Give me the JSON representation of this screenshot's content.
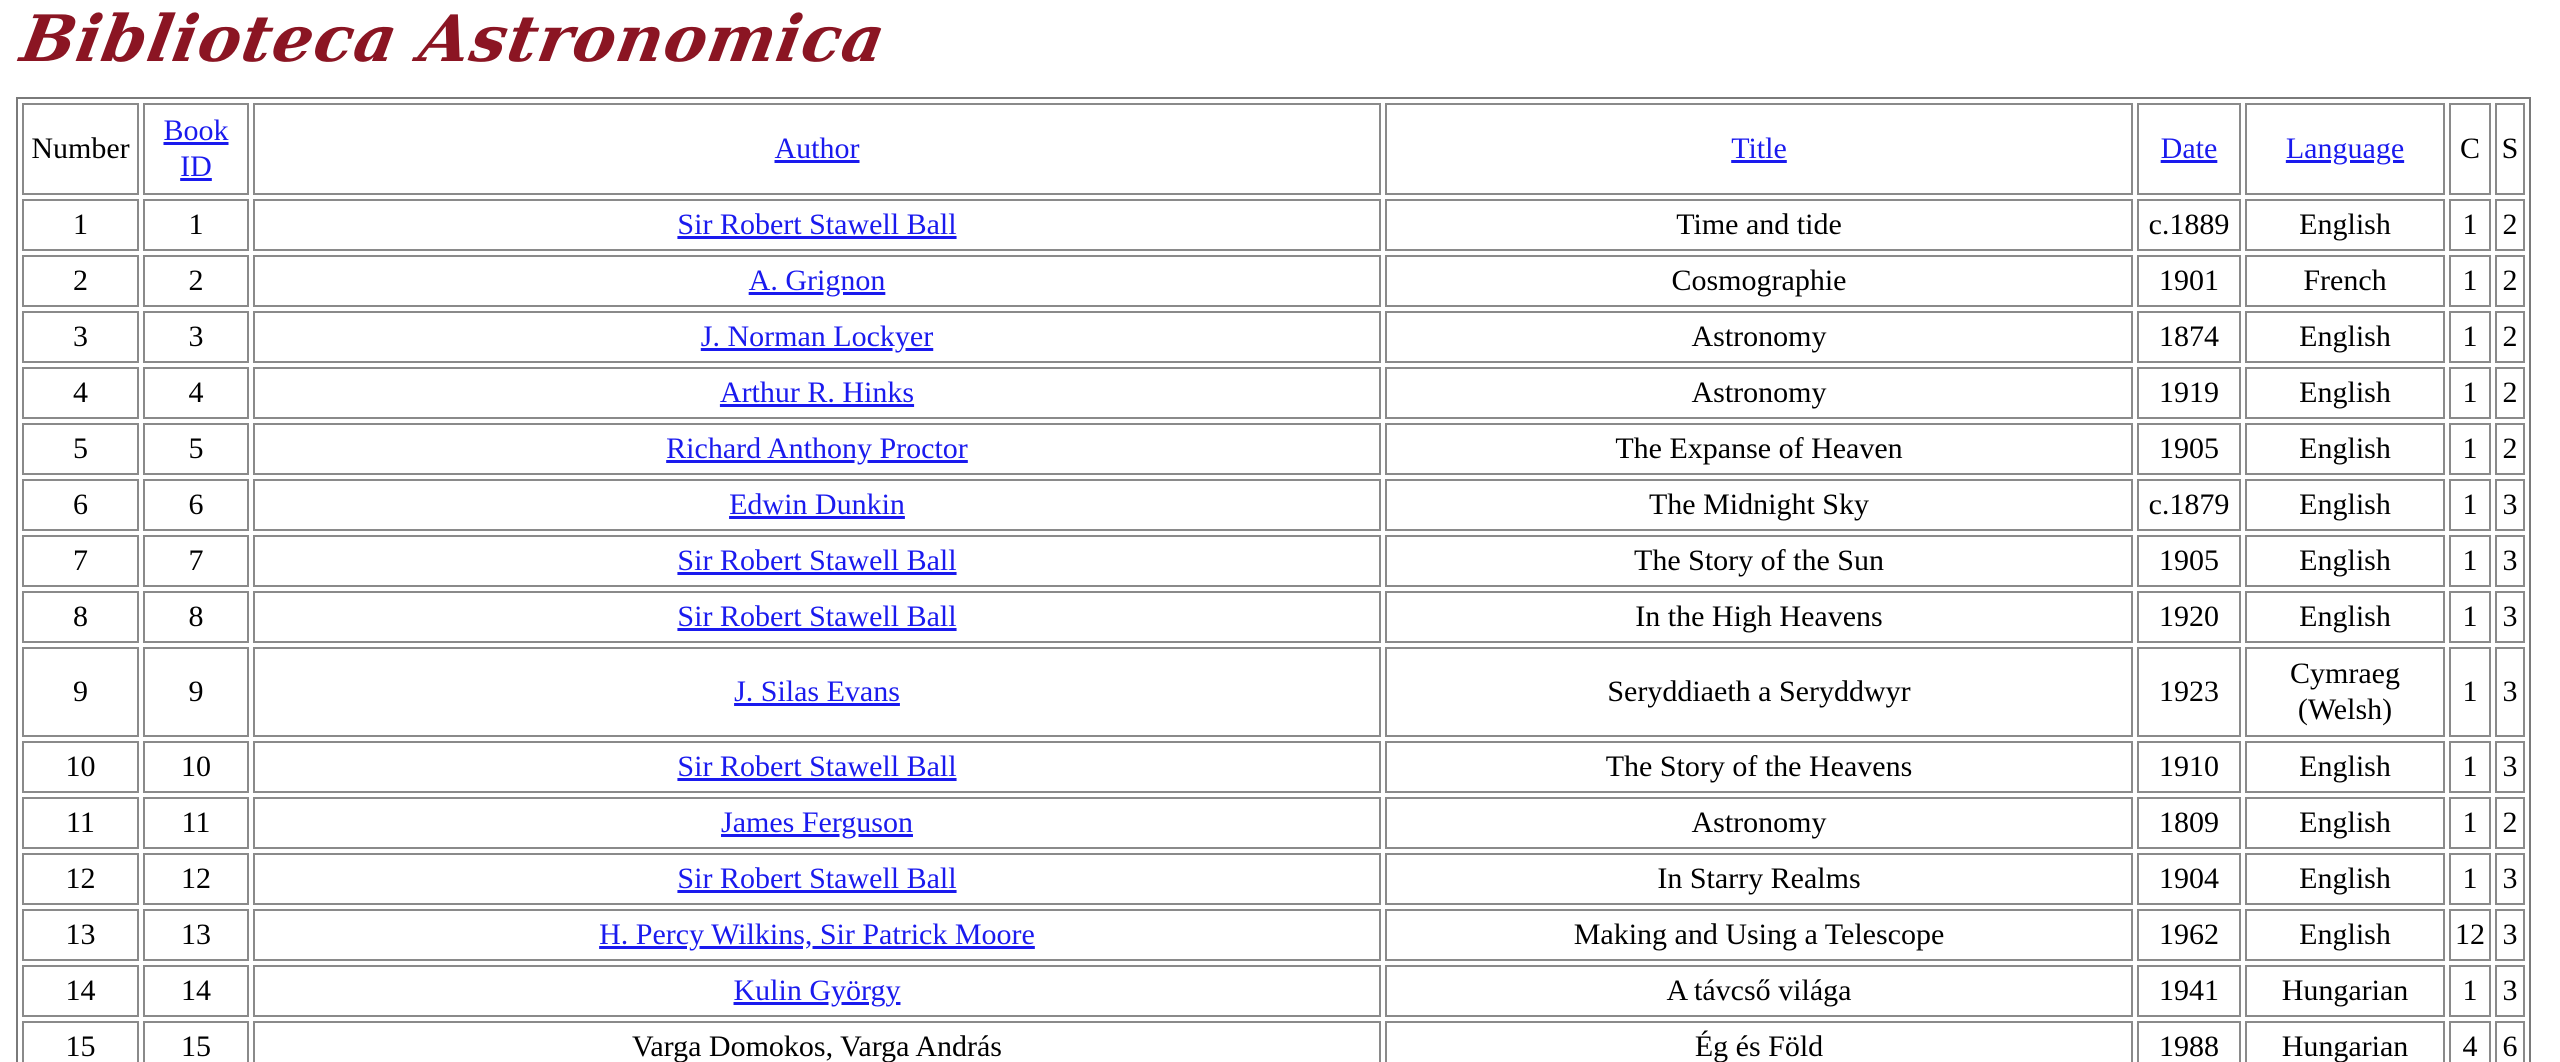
{
  "site": {
    "logo_text": "Biblioteca Astronomica"
  },
  "colors": {
    "logo": "#8b1523",
    "link": "#1a1aee",
    "border": "#8a8a8a"
  },
  "table": {
    "headers": {
      "number": "Number",
      "book_id": "Book ID",
      "author": "Author",
      "title": "Title",
      "date": "Date",
      "language": "Language",
      "c": "C",
      "s": "S"
    },
    "rows": [
      {
        "number": "1",
        "book_id": "1",
        "author": "Sir Robert Stawell Ball",
        "author_link": true,
        "title": "Time and tide",
        "date": "c.1889",
        "language": "English",
        "c": "1",
        "s": "2"
      },
      {
        "number": "2",
        "book_id": "2",
        "author": "A. Grignon",
        "author_link": true,
        "title": "Cosmographie",
        "date": "1901",
        "language": "French",
        "c": "1",
        "s": "2"
      },
      {
        "number": "3",
        "book_id": "3",
        "author": "J. Norman Lockyer",
        "author_link": true,
        "title": "Astronomy",
        "date": "1874",
        "language": "English",
        "c": "1",
        "s": "2"
      },
      {
        "number": "4",
        "book_id": "4",
        "author": "Arthur R. Hinks",
        "author_link": true,
        "title": "Astronomy",
        "date": "1919",
        "language": "English",
        "c": "1",
        "s": "2"
      },
      {
        "number": "5",
        "book_id": "5",
        "author": "Richard Anthony Proctor",
        "author_link": true,
        "title": "The Expanse of Heaven",
        "date": "1905",
        "language": "English",
        "c": "1",
        "s": "2"
      },
      {
        "number": "6",
        "book_id": "6",
        "author": "Edwin Dunkin",
        "author_link": true,
        "title": "The Midnight Sky",
        "date": "c.1879",
        "language": "English",
        "c": "1",
        "s": "3"
      },
      {
        "number": "7",
        "book_id": "7",
        "author": "Sir Robert Stawell Ball",
        "author_link": true,
        "title": "The Story of the Sun",
        "date": "1905",
        "language": "English",
        "c": "1",
        "s": "3"
      },
      {
        "number": "8",
        "book_id": "8",
        "author": "Sir Robert Stawell Ball",
        "author_link": true,
        "title": "In the High Heavens",
        "date": "1920",
        "language": "English",
        "c": "1",
        "s": "3"
      },
      {
        "number": "9",
        "book_id": "9",
        "author": "J. Silas Evans",
        "author_link": true,
        "title": "Seryddiaeth a Seryddwyr",
        "date": "1923",
        "language": "Cymraeg (Welsh)",
        "c": "1",
        "s": "3"
      },
      {
        "number": "10",
        "book_id": "10",
        "author": "Sir Robert Stawell Ball",
        "author_link": true,
        "title": "The Story of the Heavens",
        "date": "1910",
        "language": "English",
        "c": "1",
        "s": "3"
      },
      {
        "number": "11",
        "book_id": "11",
        "author": "James Ferguson",
        "author_link": true,
        "title": "Astronomy",
        "date": "1809",
        "language": "English",
        "c": "1",
        "s": "2"
      },
      {
        "number": "12",
        "book_id": "12",
        "author": "Sir Robert Stawell Ball",
        "author_link": true,
        "title": "In Starry Realms",
        "date": "1904",
        "language": "English",
        "c": "1",
        "s": "3"
      },
      {
        "number": "13",
        "book_id": "13",
        "author": "H. Percy Wilkins, Sir Patrick Moore",
        "author_link": true,
        "title": "Making and Using a Telescope",
        "date": "1962",
        "language": "English",
        "c": "12",
        "s": "3"
      },
      {
        "number": "14",
        "book_id": "14",
        "author": "Kulin György",
        "author_link": true,
        "title": "A távcső világa",
        "date": "1941",
        "language": "Hungarian",
        "c": "1",
        "s": "3"
      },
      {
        "number": "15",
        "book_id": "15",
        "author": "Varga Domokos, Varga András",
        "author_link": false,
        "title": "Ég és Föld",
        "date": "1988",
        "language": "Hungarian",
        "c": "4",
        "s": "6"
      }
    ]
  }
}
